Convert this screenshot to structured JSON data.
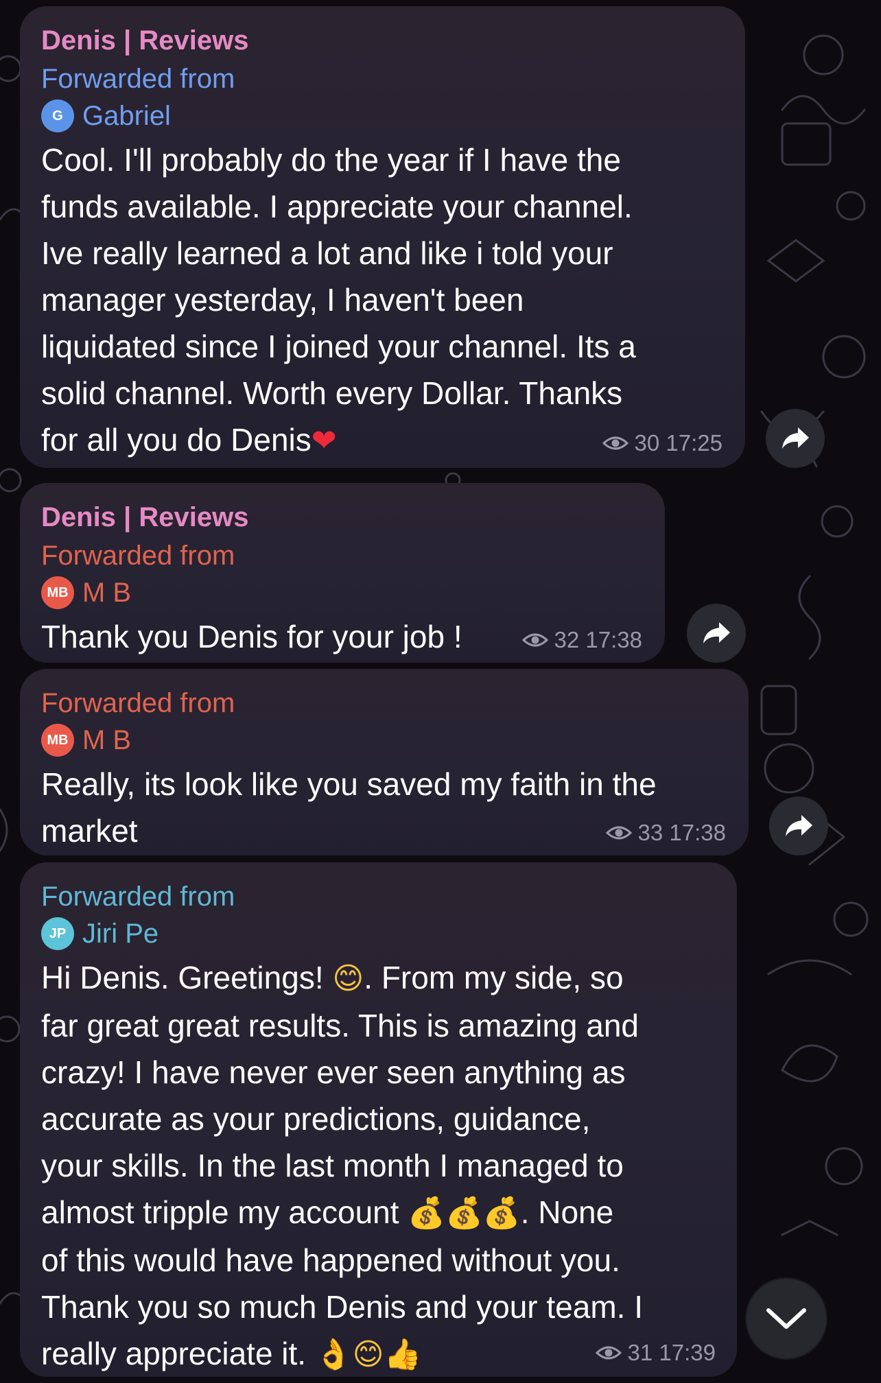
{
  "colors": {
    "channel_name": "#e58ac4",
    "forward_gabriel": "#6f9ef0",
    "forward_mb": "#e0644f",
    "forward_jiri": "#5fb8d6",
    "avatar_gabriel": "#5b93e8",
    "avatar_mb": "#e9594a",
    "avatar_jiri": "#5cc3d8",
    "meta": "#9b98a8"
  },
  "messages": [
    {
      "channel_name": "Denis | Reviews",
      "forwarded_label": "Forwarded from",
      "avatar_initials": "G",
      "forwarded_name": "Gabriel",
      "lines": [
        "Cool. I'll probably do the year if I have the",
        "funds available.  I appreciate your channel.",
        "Ive really learned a lot and like i told your",
        "manager yesterday,  I haven't been",
        "liquidated since I joined your channel. Its a",
        "solid channel. Worth every Dollar.  Thanks",
        "for all you do Denis"
      ],
      "trailing_emoji": "❤",
      "views": "30",
      "time": "17:25"
    },
    {
      "channel_name": "Denis | Reviews",
      "forwarded_label": "Forwarded from",
      "avatar_initials": "MB",
      "forwarded_name": "M B",
      "lines": [
        "Thank you Denis for your job !"
      ],
      "views": "32",
      "time": "17:38"
    },
    {
      "forwarded_label": "Forwarded from",
      "avatar_initials": "MB",
      "forwarded_name": "M B",
      "lines": [
        "Really, its look like you saved my faith in the",
        "market"
      ],
      "views": "33",
      "time": "17:38"
    },
    {
      "forwarded_label": "Forwarded from",
      "avatar_initials": "JP",
      "forwarded_name": "Jiri Pe",
      "line1_before_emoji": "Hi Denis. Greetings! ",
      "line1_emoji": "😊",
      "line1_after_emoji": ". From my side, so",
      "lines_mid": [
        "far great great results. This is amazing and",
        "crazy!  I have never ever seen anything as",
        "accurate as your predictions, guidance,",
        "your skills. In the last month I managed to"
      ],
      "line6_text": "almost tripple my account ",
      "line6_emoji": "💰💰💰",
      "line6_after": ". None",
      "lines_end": [
        "of this would have happened without you.",
        "Thank you so much Denis and your team. I"
      ],
      "last_line_text": "really appreciate it. ",
      "last_line_emoji": "👌😊👍",
      "views": "31",
      "time": "17:39"
    }
  ],
  "icons": {
    "views": "eye-icon",
    "share": "share-arrow-icon",
    "scroll_down": "chevron-down-icon"
  }
}
